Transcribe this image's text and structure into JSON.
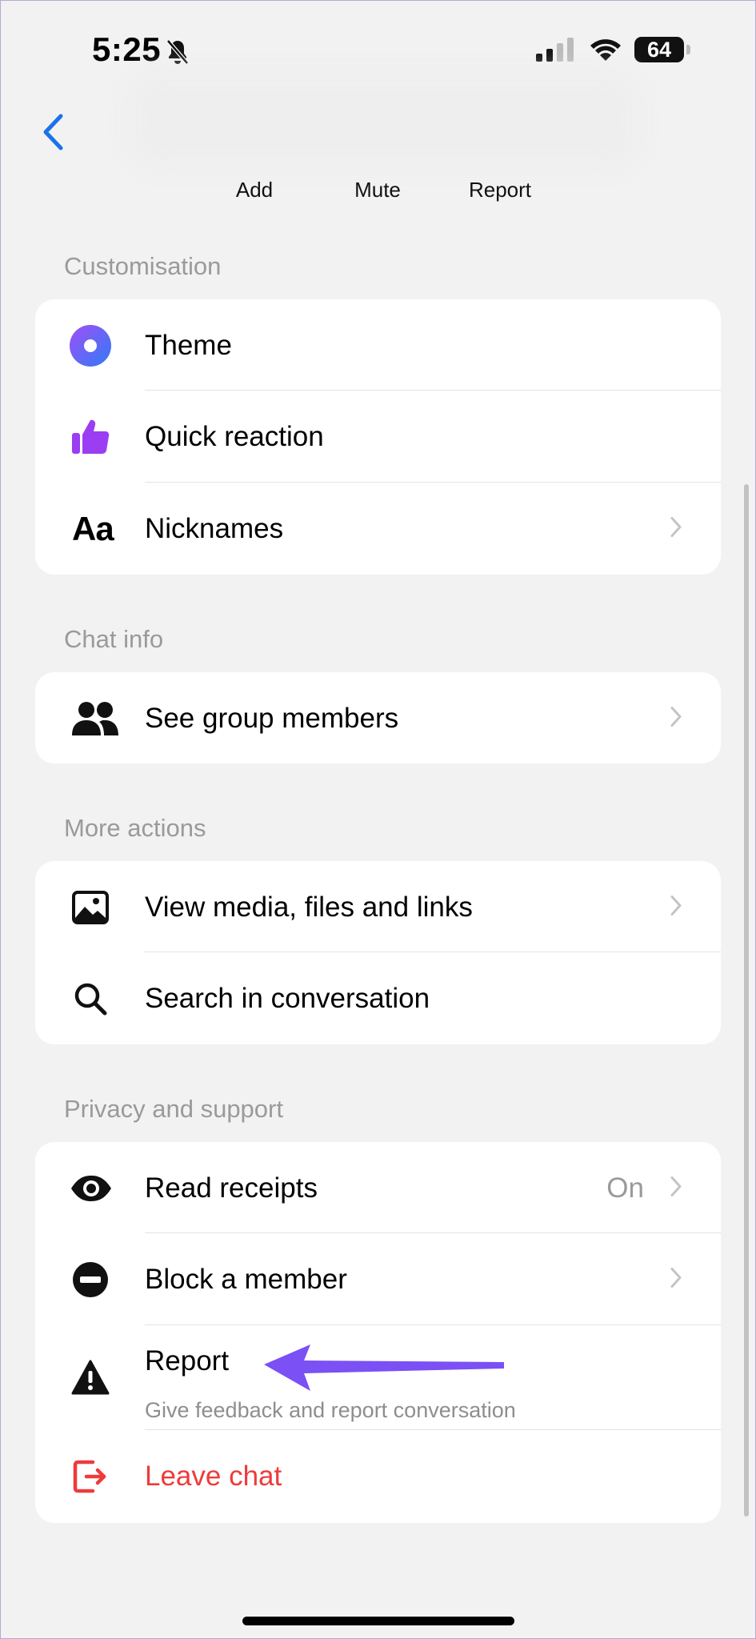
{
  "status_bar": {
    "time": "5:25",
    "battery": "64"
  },
  "header": {
    "actions": [
      "Add",
      "Mute",
      "Report"
    ]
  },
  "colors": {
    "accent": "#1a73e8",
    "theme_icon": "#6b4cf5",
    "thumb_icon": "#9b3df2",
    "leave": "#ee3b3b",
    "arrow": "#7b50f4"
  },
  "sections": {
    "customisation": {
      "title": "Customisation",
      "items": [
        {
          "label": "Theme",
          "icon": "theme-icon"
        },
        {
          "label": "Quick reaction",
          "icon": "thumbs-up-icon"
        },
        {
          "label": "Nicknames",
          "icon": "text-aa-icon"
        }
      ]
    },
    "chat_info": {
      "title": "Chat info",
      "items": [
        {
          "label": "See group members",
          "icon": "people-icon"
        }
      ]
    },
    "more_actions": {
      "title": "More actions",
      "items": [
        {
          "label": "View media, files and links",
          "icon": "image-icon"
        },
        {
          "label": "Search in conversation",
          "icon": "search-icon"
        }
      ]
    },
    "privacy": {
      "title": "Privacy and support",
      "items": [
        {
          "label": "Read receipts",
          "value": "On",
          "icon": "eye-icon"
        },
        {
          "label": "Block a member",
          "icon": "minus-circle-icon"
        },
        {
          "label": "Report",
          "sublabel": "Give feedback and report conversation",
          "icon": "warning-icon"
        },
        {
          "label": "Leave chat",
          "icon": "leave-icon"
        }
      ]
    }
  }
}
